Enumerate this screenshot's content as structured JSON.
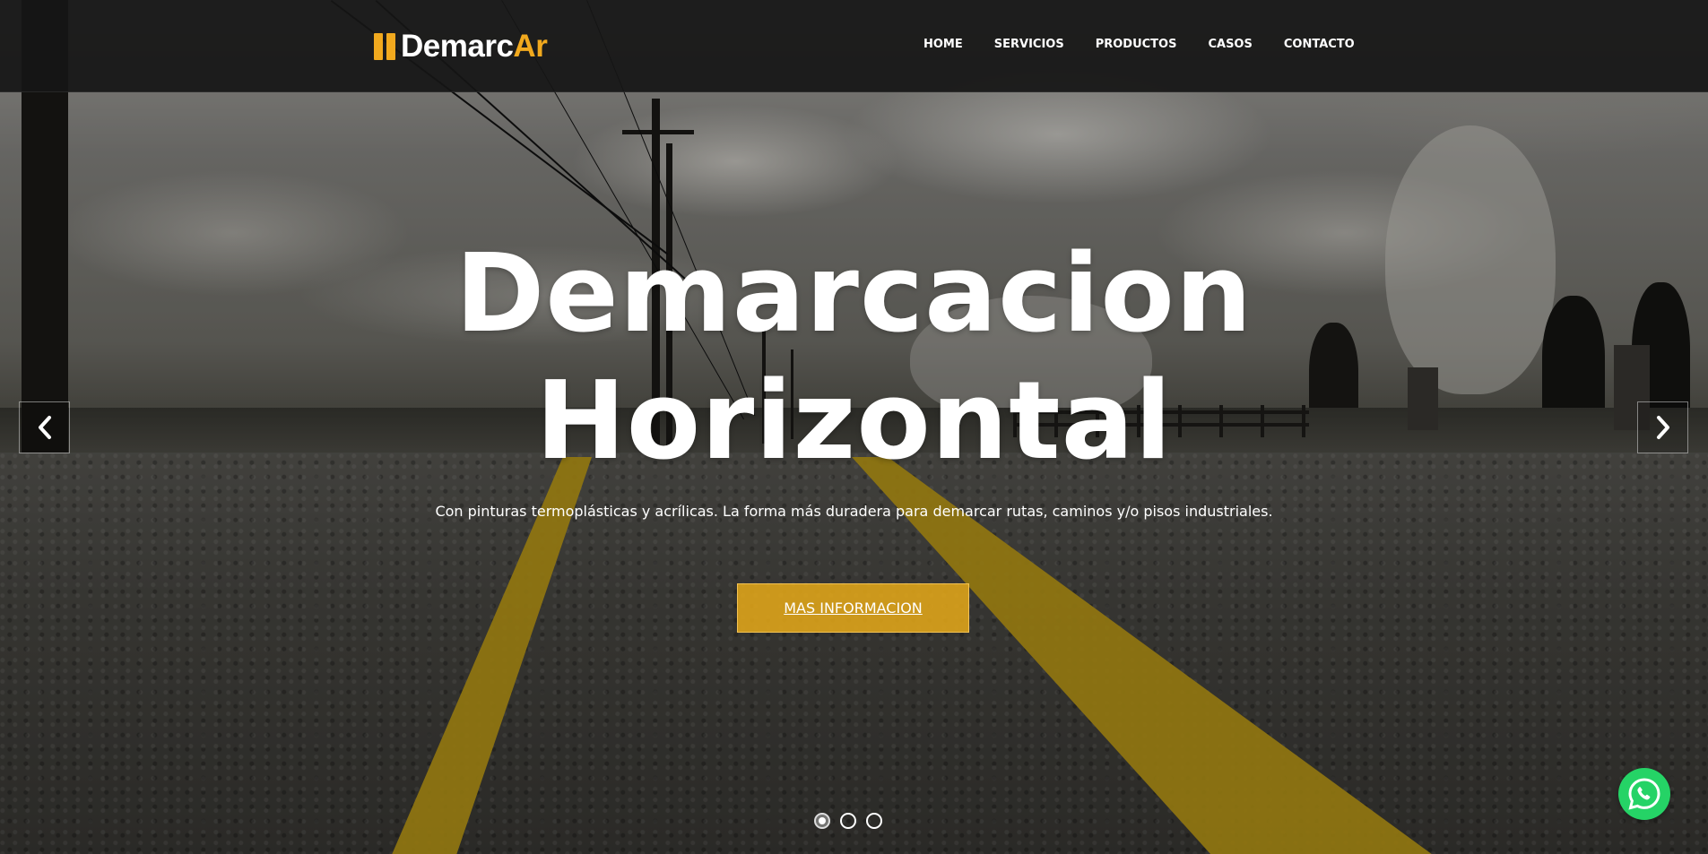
{
  "brand": {
    "name_part1": "Demarc",
    "name_part2": "Ar",
    "accent_color": "#f1a91e"
  },
  "nav": {
    "items": [
      {
        "label": "HOME"
      },
      {
        "label": "SERVICIOS"
      },
      {
        "label": "PRODUCTOS"
      },
      {
        "label": "CASOS"
      },
      {
        "label": "CONTACTO"
      }
    ]
  },
  "hero": {
    "title_line1": "Demarcacion",
    "title_line2": "Horizontal",
    "subtitle": "Con pinturas termoplásticas y acrílicas. La forma más duradera para demarcar rutas, caminos y/o pisos industriales.",
    "button_label": "MAS INFORMACION",
    "button_color": "#e1a619"
  },
  "carousel": {
    "prev_icon": "chevron-left-icon",
    "next_icon": "chevron-right-icon",
    "slide_count": 3,
    "active_slide": 1
  },
  "floating": {
    "icon": "whatsapp-icon",
    "color": "#25d366"
  }
}
